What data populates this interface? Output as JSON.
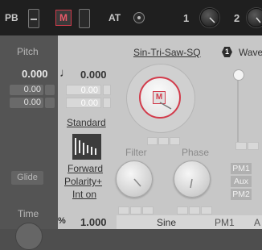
{
  "topbar": {
    "pb_label": "PB",
    "m_label": "M",
    "at_label": "AT",
    "knob1_label": "1",
    "knob2_label": "2"
  },
  "left": {
    "pitch_label": "Pitch",
    "pitch_value": "0.000",
    "pitch_sub1": "0.00",
    "pitch_sub2": "0.00",
    "glide_label": "Glide",
    "time_label": "Time"
  },
  "main": {
    "note_icon": "♩",
    "note_value": "0.000",
    "note_sub1": "0.00",
    "note_sub2": "0.00",
    "standard_label": "Standard",
    "forward_label": "Forward",
    "polarity_label": "Polarity+",
    "int_label": "Int on",
    "percent_icon": "%",
    "percent_value": "1.000",
    "wave_title": "Sin-Tri-Saw-SQ",
    "wave_badge_num": "1",
    "wave_label": "Wave",
    "wheel_m": "M",
    "filter_label": "Filter",
    "phase_label": "Phase",
    "pm1_label": "PM1",
    "aux_label": "Aux",
    "pm2_label": "PM2",
    "bottom_sine": "Sine",
    "bottom_pm1": "PM1",
    "bottom_a": "A"
  },
  "colors": {
    "accent_red": "#d23b4b",
    "panel_light": "#c7c7c7",
    "panel_dark": "#545454",
    "topbar": "#1f1f1f"
  }
}
